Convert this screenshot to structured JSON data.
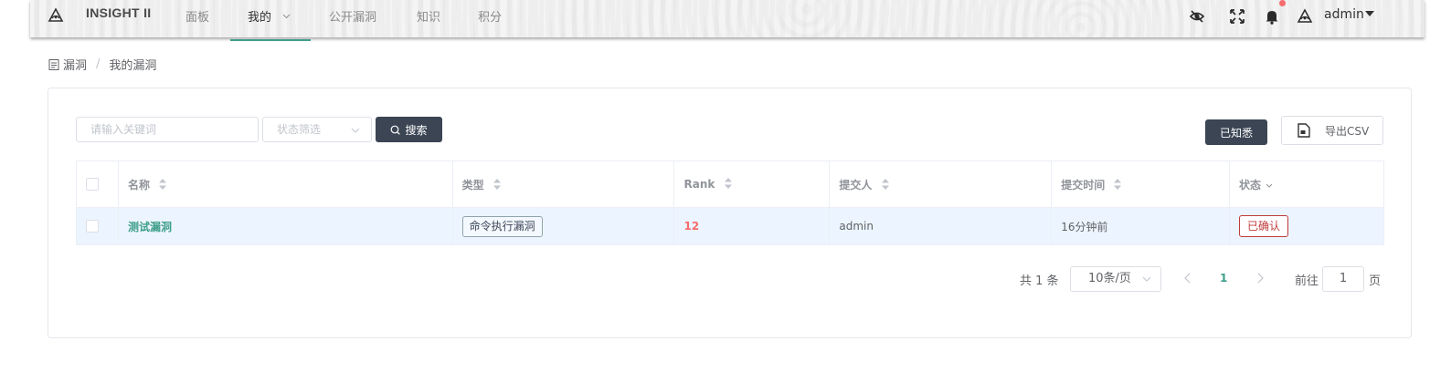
{
  "app": {
    "brand": "INSIGHT II"
  },
  "nav": {
    "items": [
      {
        "label": "面板",
        "active": false
      },
      {
        "label": "我的",
        "active": true
      },
      {
        "label": "公开漏洞",
        "active": false
      },
      {
        "label": "知识",
        "active": false
      },
      {
        "label": "积分",
        "active": false
      }
    ],
    "accent_color": "#3f9e8a"
  },
  "topbar_icons": [
    "eye-off-icon",
    "fullscreen-icon",
    "bell-icon",
    "logo-icon"
  ],
  "user": {
    "name": "admin"
  },
  "breadcrumb": {
    "root": "漏洞",
    "separator": "/",
    "current": "我的漏洞"
  },
  "filters": {
    "keyword_placeholder": "请输入关键词",
    "status_placeholder": "状态筛选",
    "search_label": "搜索"
  },
  "actions": {
    "acknowledge_label": "已知悉",
    "export_label": "导出CSV"
  },
  "table": {
    "columns": [
      "名称",
      "类型",
      "Rank",
      "提交人",
      "提交时间",
      "状态"
    ],
    "rows": [
      {
        "name": "测试漏洞",
        "type": "命令执行漏洞",
        "rank": "12",
        "submitter": "admin",
        "time": "16分钟前",
        "status": "已确认"
      }
    ]
  },
  "pagination": {
    "total_text": "共 1 条",
    "page_size": "10条/页",
    "current_page": "1",
    "goto_label": "前往",
    "goto_value": "1",
    "page_suffix": "页"
  },
  "colors": {
    "dark_button": "#3b4554",
    "rank": "#f56c6c",
    "status": "#bf3b3b",
    "row_highlight": "#ecf5ff"
  }
}
